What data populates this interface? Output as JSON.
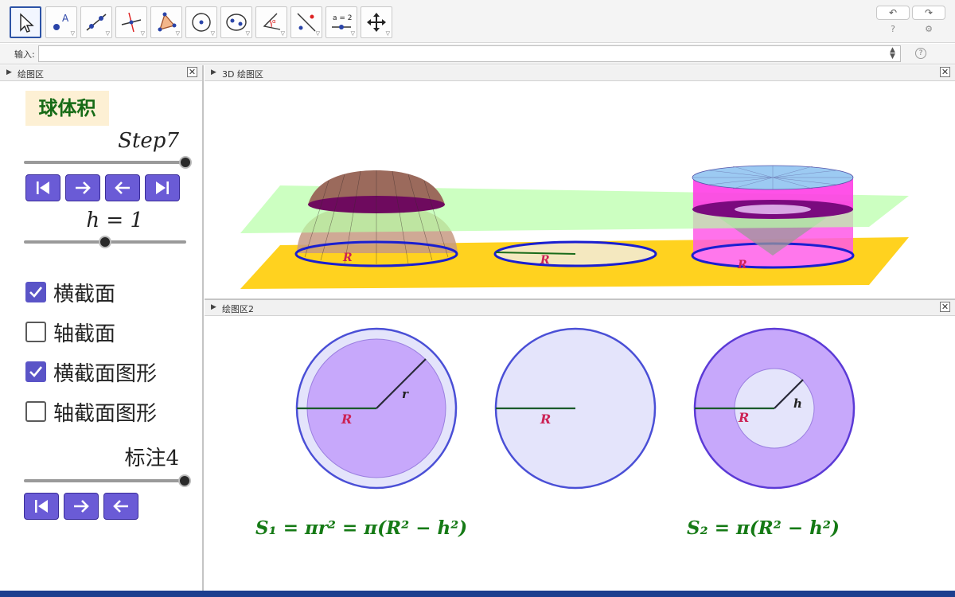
{
  "toolbar": {
    "tools": [
      {
        "name": "move-tool",
        "active": true
      },
      {
        "name": "point-tool"
      },
      {
        "name": "line-tool"
      },
      {
        "name": "perpendicular-tool"
      },
      {
        "name": "polygon-tool"
      },
      {
        "name": "circle-tool"
      },
      {
        "name": "ellipse-tool"
      },
      {
        "name": "angle-tool"
      },
      {
        "name": "reflect-tool"
      },
      {
        "name": "slider-tool",
        "label": "a = 2"
      },
      {
        "name": "move-view-tool"
      }
    ],
    "undo_glyph": "↶",
    "redo_glyph": "↷"
  },
  "input_bar": {
    "label": "输入:",
    "value": ""
  },
  "panels": {
    "algebra": {
      "title": "绘图区"
    },
    "view3d": {
      "title": "3D 绘图区"
    },
    "view2": {
      "title": "绘图区2"
    }
  },
  "left": {
    "title": "球体积",
    "step_slider": {
      "label": "Step7",
      "value_fraction": 1.0
    },
    "h_slider": {
      "label": "h = 1",
      "value_fraction": 0.5
    },
    "checkboxes": [
      {
        "label": "横截面",
        "checked": true
      },
      {
        "label": "轴截面",
        "checked": false
      },
      {
        "label": "横截面图形",
        "checked": true
      },
      {
        "label": "轴截面图形",
        "checked": false
      }
    ],
    "label_slider": {
      "label": "标注4",
      "value_fraction": 1.0
    }
  },
  "view3d_labels": {
    "radius": "R"
  },
  "view2": {
    "radius_label": "R",
    "r_label": "r",
    "h_label": "h",
    "formula1": "S₁ = πr² = π(R² − h²)",
    "formula2": "S₂ = π(R² − h²)"
  },
  "colors": {
    "accent_purple": "#6a5bd6",
    "formula_green": "#157a15",
    "label_red": "#cc2255",
    "title_bg": "#fdf0d4"
  }
}
